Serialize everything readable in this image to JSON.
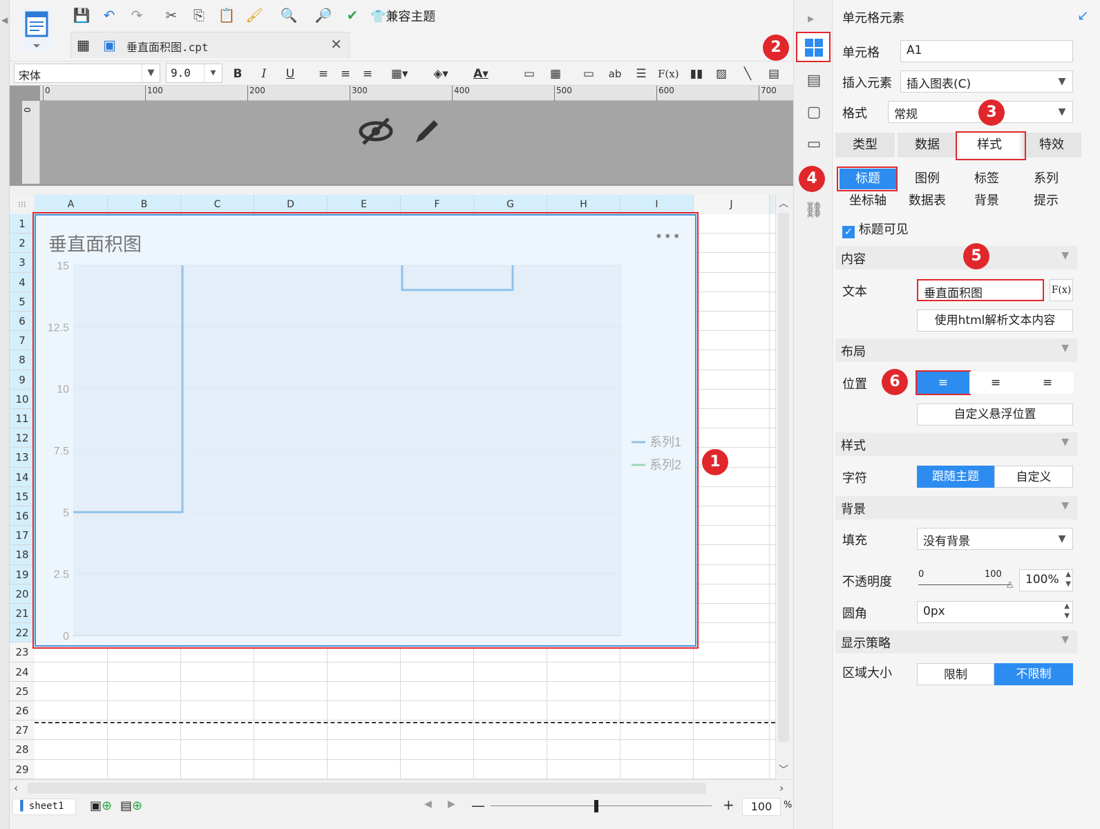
{
  "toolbar": {
    "compat_theme": "兼容主题"
  },
  "file_tab": {
    "name": "垂直面积图.cpt"
  },
  "format": {
    "font": "宋体",
    "size": "9.0",
    "bold": "B",
    "italic": "I",
    "underline": "U",
    "text_ab": "ab",
    "fx": "F(x)"
  },
  "ruler": {
    "ticks": [
      "0",
      "100",
      "200",
      "300",
      "400",
      "500",
      "600",
      "700"
    ],
    "v_tick": "0"
  },
  "grid": {
    "columns": [
      "A",
      "B",
      "C",
      "D",
      "E",
      "F",
      "G",
      "H",
      "I",
      "J"
    ],
    "rows": [
      "1",
      "2",
      "3",
      "4",
      "5",
      "6",
      "7",
      "8",
      "9",
      "10",
      "11",
      "12",
      "13",
      "14",
      "15",
      "16",
      "17",
      "18",
      "19",
      "20",
      "21",
      "22",
      "23",
      "24",
      "25",
      "26",
      "27",
      "28",
      "29"
    ]
  },
  "chart_data": {
    "type": "area",
    "title": "垂直面积图",
    "x": [],
    "series": [
      {
        "name": "系列1",
        "color": "#8fc3ea"
      },
      {
        "name": "系列2",
        "color": "#9dd9b8"
      }
    ],
    "yticks": [
      "15",
      "12.5",
      "10",
      "7.5",
      "5",
      "2.5",
      "0"
    ],
    "ylim": [
      0,
      15
    ],
    "legend_position": "right",
    "menu": "•••"
  },
  "sheetbar": {
    "sheet": "sheet1",
    "zoom": "100",
    "zoom_unit": "%"
  },
  "panel": {
    "header": "单元格元素",
    "cell_label": "单元格",
    "cell_value": "A1",
    "insert_label": "插入元素",
    "insert_value": "插入图表(C)",
    "format_label": "格式",
    "format_value": "常规",
    "tabs": [
      "类型",
      "数据",
      "样式",
      "特效"
    ],
    "subtabs": [
      "标题",
      "图例",
      "标签",
      "系列",
      "坐标轴",
      "数据表",
      "背景",
      "提示"
    ],
    "title_visible": "标题可见",
    "sec_content": "内容",
    "text_label": "文本",
    "text_value": "垂直面积图",
    "fx": "F(x)",
    "html_btn": "使用html解析文本内容",
    "sec_layout": "布局",
    "position_label": "位置",
    "custom_float": "自定义悬浮位置",
    "sec_style": "样式",
    "char_label": "字符",
    "follow_theme": "跟随主题",
    "custom": "自定义",
    "sec_bg": "背景",
    "fill_label": "填充",
    "fill_value": "没有背景",
    "opacity_label": "不透明度",
    "opacity_min": "0",
    "opacity_max": "100",
    "opacity_value": "100%",
    "radius_label": "圆角",
    "radius_value": "0px",
    "sec_strategy": "显示策略",
    "area_label": "区域大小",
    "limit": "限制",
    "no_limit": "不限制"
  },
  "badges": [
    "1",
    "2",
    "3",
    "4",
    "5",
    "6"
  ],
  "colors": {
    "accent": "#2d8cf0",
    "annotation": "#e0272b",
    "selected_header": "#d4eefc"
  }
}
